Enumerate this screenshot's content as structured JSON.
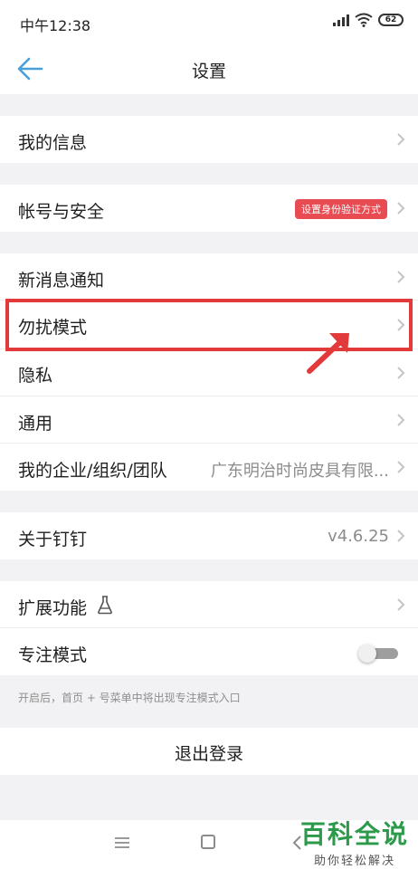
{
  "status": {
    "time": "中午12:38",
    "battery": "62"
  },
  "nav": {
    "title": "设置"
  },
  "rows": {
    "my_info": "我的信息",
    "account_security": "帐号与安全",
    "account_badge": "设置身份验证方式",
    "new_msg": "新消息通知",
    "dnd": "勿扰模式",
    "privacy": "隐私",
    "general": "通用",
    "org": "我的企业/组织/团队",
    "org_value": "广东明治时尚皮具有限...",
    "about": "关于钉钉",
    "about_value": "v4.6.25",
    "extensions": "扩展功能",
    "focus": "专注模式"
  },
  "focus_mode": {
    "enabled": false
  },
  "hint": "开启后，首页 + 号菜单中将出现专注模式入口",
  "logout": "退出登录",
  "watermark": {
    "main": "百科全说",
    "sub": "助你轻松解决"
  },
  "colors": {
    "accent": "#4a9fd8",
    "badge": "#e84b52",
    "highlight": "#e23a3a",
    "watermark": "#2b9a4a"
  }
}
